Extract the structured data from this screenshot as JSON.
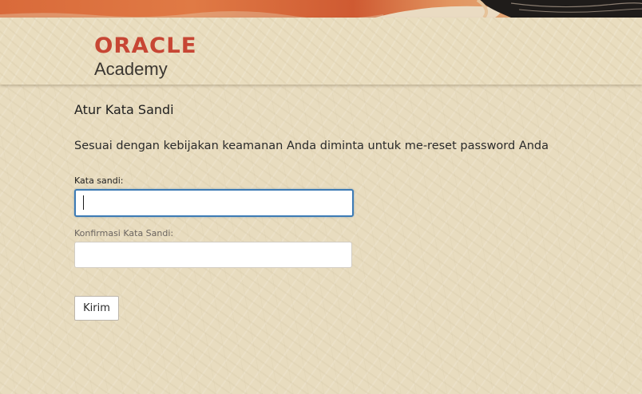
{
  "brand": {
    "name": "ORACLE",
    "subtitle": "Academy",
    "accent_color": "#c74634"
  },
  "form": {
    "title": "Atur Kata Sandi",
    "message": "Sesuai dengan kebijakan keamanan Anda diminta untuk me-reset password Anda",
    "password_label": "Kata sandi:",
    "password_value": "",
    "confirm_label": "Konfirmasi Kata Sandi:",
    "confirm_value": "",
    "submit_label": "Kirim"
  },
  "colors": {
    "background": "#e8dcbf",
    "focus_border": "#3d7bb5"
  }
}
